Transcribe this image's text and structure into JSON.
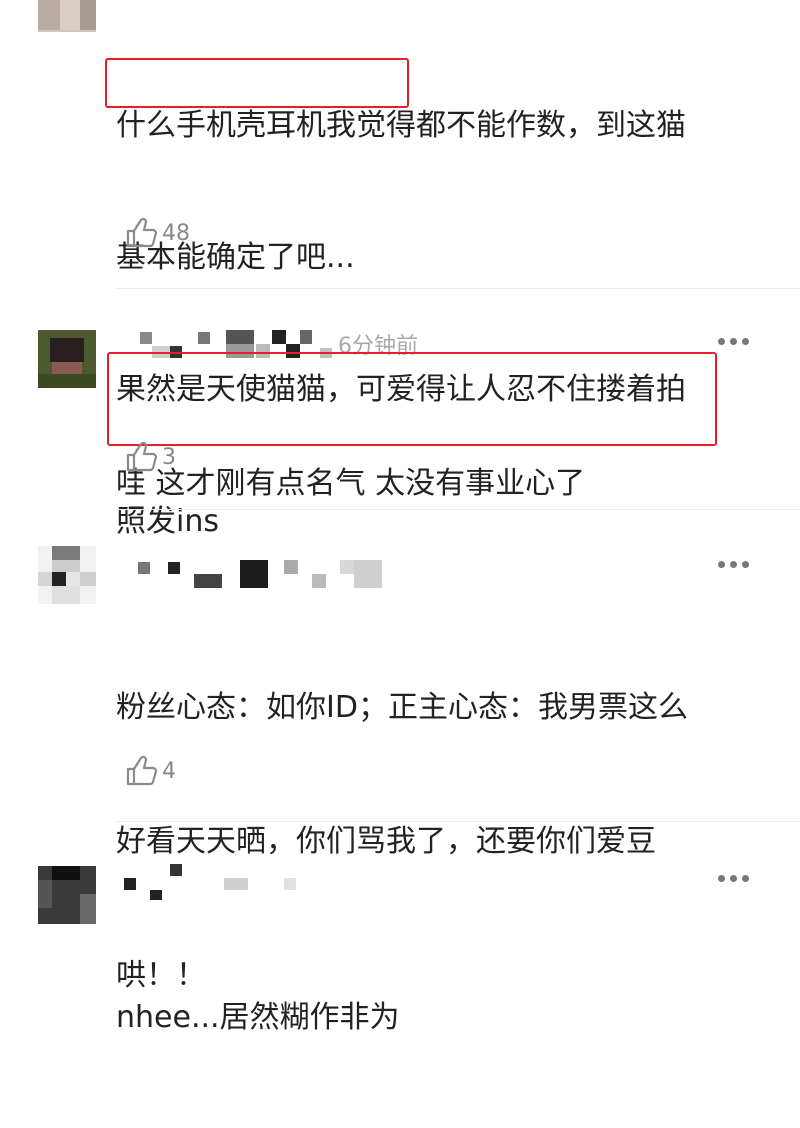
{
  "comments": [
    {
      "text_lines": [
        "什么手机壳耳机我觉得都不能作数，到这猫",
        "基本能确定了吧...",
        "果然是天使猫猫，可爱得让人忍不住搂着拍",
        "照发ins"
      ],
      "likes": "48"
    },
    {
      "time": "6分钟前",
      "text_lines": [
        "哇 这才刚有点名气 太没有事业心了"
      ],
      "likes": "3"
    },
    {
      "text_lines": [
        "粉丝心态：如你ID；正主心态：我男票这么",
        "好看天天晒，你们骂我了，还要你们爱豆",
        "哄！！"
      ],
      "likes": "4"
    },
    {
      "text_lines": [
        "nhee...居然糊作非为"
      ]
    }
  ],
  "icons": {
    "like": "thumbs-up-icon",
    "more": "more-dots-icon"
  },
  "colors": {
    "highlight": "#e5202a",
    "meta": "#aaaaaa",
    "text": "#222222"
  }
}
